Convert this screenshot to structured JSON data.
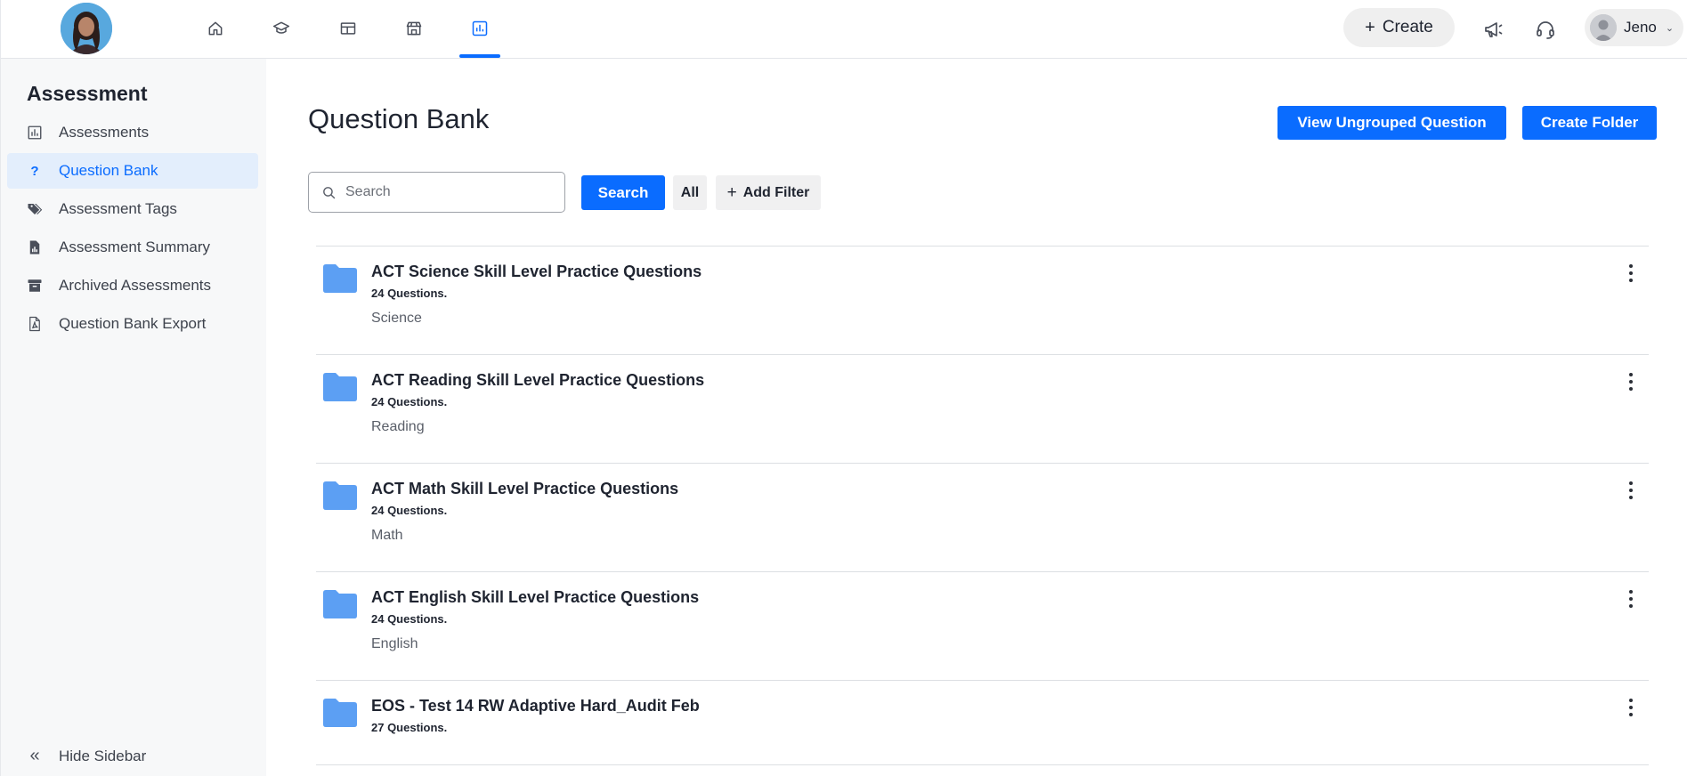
{
  "header": {
    "nav": [
      {
        "name": "home-icon"
      },
      {
        "name": "graduation-cap-icon"
      },
      {
        "name": "dashboard-icon"
      },
      {
        "name": "store-icon"
      },
      {
        "name": "analytics-icon",
        "active": true
      }
    ],
    "create_label": "Create",
    "user_name": "Jeno",
    "accent": "#0a6cff"
  },
  "sidebar": {
    "title": "Assessment",
    "items": [
      {
        "label": "Assessments",
        "icon": "bar-chart-icon"
      },
      {
        "label": "Question Bank",
        "icon": "question-mark-icon",
        "active": true
      },
      {
        "label": "Assessment Tags",
        "icon": "tags-icon"
      },
      {
        "label": "Assessment Summary",
        "icon": "report-icon"
      },
      {
        "label": "Archived Assessments",
        "icon": "archive-icon"
      },
      {
        "label": "Question Bank Export",
        "icon": "pdf-file-icon"
      }
    ],
    "hide_label": "Hide Sidebar"
  },
  "main": {
    "title": "Question Bank",
    "view_ungrouped_label": "View Ungrouped Question",
    "create_folder_label": "Create Folder",
    "search_placeholder": "Search",
    "search_label": "Search",
    "all_label": "All",
    "add_filter_label": "Add Filter",
    "folders": [
      {
        "name": "ACT Science Skill Level Practice Questions",
        "count": "24 Questions.",
        "tag": "Science"
      },
      {
        "name": "ACT Reading Skill Level Practice Questions",
        "count": "24 Questions.",
        "tag": "Reading"
      },
      {
        "name": "ACT Math Skill Level Practice Questions",
        "count": "24 Questions.",
        "tag": "Math"
      },
      {
        "name": "ACT English Skill Level Practice Questions",
        "count": "24 Questions.",
        "tag": "English"
      },
      {
        "name": "EOS - Test 14 RW Adaptive Hard_Audit Feb",
        "count": "27 Questions.",
        "tag": ""
      }
    ]
  }
}
